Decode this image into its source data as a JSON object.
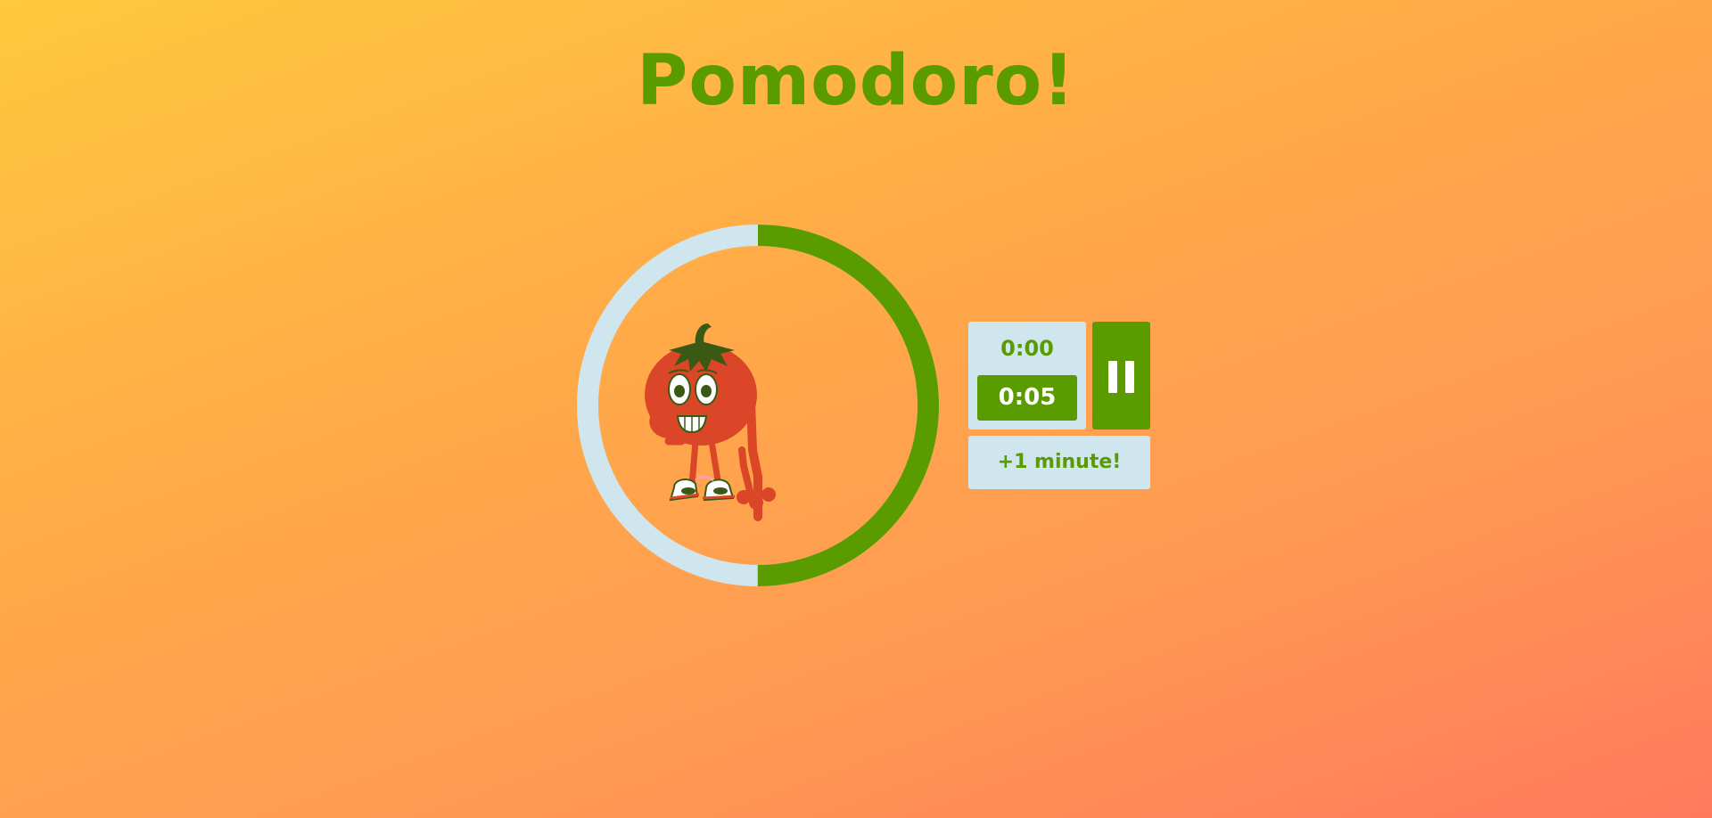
{
  "app": {
    "title": "Pomodoro!"
  },
  "timer": {
    "elapsed": "0:00",
    "duration": "0:05",
    "progress_fraction": 0.5,
    "pause_icon": "pause-icon"
  },
  "actions": {
    "add_minute_label": "+1 minute!"
  },
  "colors": {
    "accent_green": "#5a9c00",
    "panel_light_blue": "#cfe6ef",
    "tomato_red": "#dc4628",
    "leaf_dark_green": "#3a5a14",
    "background_top": "#ffc83d",
    "background_bottom": "#ff7a5c"
  }
}
